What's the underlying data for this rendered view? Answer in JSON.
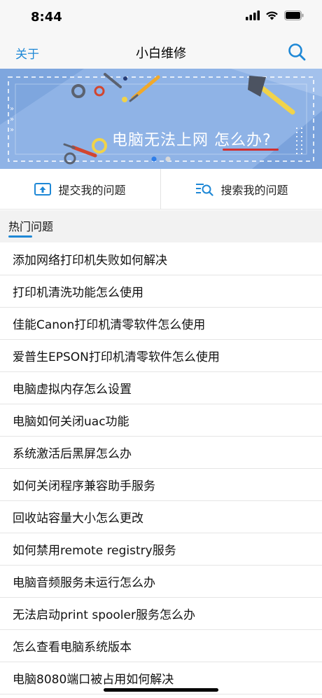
{
  "status_bar": {
    "time": "8:44"
  },
  "nav": {
    "left_label": "关于",
    "title": "小白维修"
  },
  "banner": {
    "text_main": "电脑无法上网 ",
    "text_highlight": "怎么办",
    "text_q": "?"
  },
  "actions": {
    "submit_label": "提交我的问题",
    "search_label": "搜索我的问题"
  },
  "section": {
    "title": "热门问题"
  },
  "hot_questions": [
    "添加网络打印机失败如何解决",
    "打印机清洗功能怎么使用",
    "佳能Canon打印机清零软件怎么使用",
    "爱普生EPSON打印机清零软件怎么使用",
    "电脑虚拟内存怎么设置",
    "电脑如何关闭uac功能",
    "系统激活后黑屏怎么办",
    "如何关闭程序兼容助手服务",
    "回收站容量大小怎么更改",
    "如何禁用remote registry服务",
    "电脑音频服务未运行怎么办",
    "无法启动print spooler服务怎么办",
    "怎么查看电脑系统版本",
    "电脑8080端口被占用如何解决"
  ],
  "colors": {
    "accent": "#1e88d6",
    "banner_bg": "#8fb3e6"
  }
}
